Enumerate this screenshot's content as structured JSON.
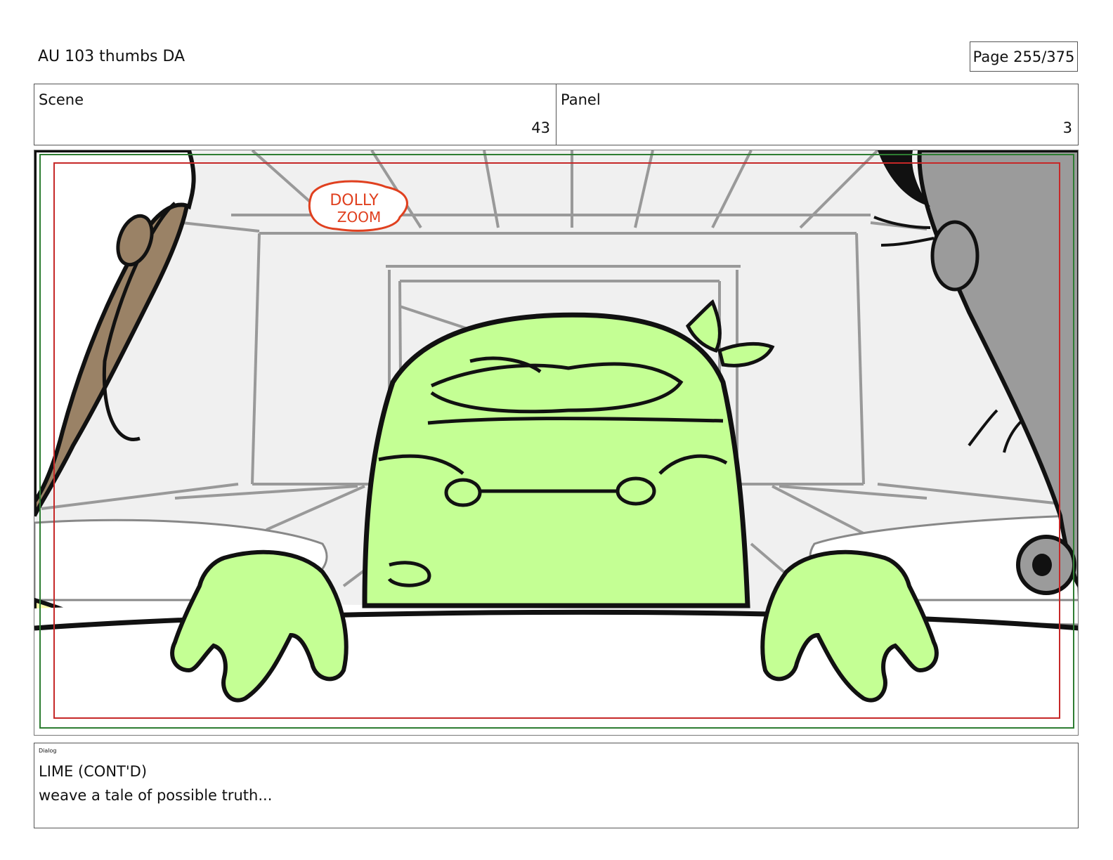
{
  "header": {
    "doc_title": "AU 103 thumbs DA",
    "page_label": "Page 255/375"
  },
  "scene": {
    "label": "Scene",
    "value": "43"
  },
  "panel": {
    "label": "Panel",
    "value": "3"
  },
  "artwork": {
    "sign_text_line1": "DOLLY",
    "sign_text_line2": "ZOOM",
    "colors": {
      "background": "#f0f0f0",
      "lime": "#c4ff94",
      "left_character": "#9a8266",
      "right_character": "#9b9b9b",
      "lower_left_character": "#fffaa8",
      "sign_red": "#e0401f"
    }
  },
  "dialog": {
    "tag": "Dialog",
    "speaker": "LIME (CONT'D)",
    "line": "weave a tale of possible truth..."
  }
}
